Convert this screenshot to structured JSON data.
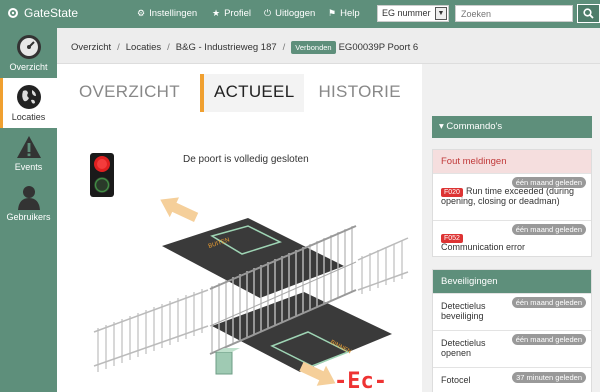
{
  "app": {
    "title": "GateState"
  },
  "topnav": {
    "instellingen": "Instellingen",
    "profiel": "Profiel",
    "uitloggen": "Uitloggen",
    "help": "Help"
  },
  "search": {
    "select_value": "EG nummer",
    "placeholder": "Zoeken"
  },
  "sidebar": {
    "items": [
      {
        "label": "Overzicht",
        "icon": "gauge-icon"
      },
      {
        "label": "Locaties",
        "icon": "globe-icon"
      },
      {
        "label": "Events",
        "icon": "warning-icon"
      },
      {
        "label": "Gebruikers",
        "icon": "user-icon"
      }
    ]
  },
  "breadcrumb": {
    "items": [
      "Overzicht",
      "Locaties",
      "B&G - Industrieweg 187"
    ],
    "badge": "Verbonden",
    "current": "EG00039P Poort 6"
  },
  "tabs": [
    "OVERZICHT",
    "ACTUEEL",
    "HISTORIE"
  ],
  "status": {
    "text": "De poort is volledig gesloten"
  },
  "gate": {
    "label_outside": "BUITEN",
    "label_inside": "BINNEN",
    "display": "-Ec-"
  },
  "commands": {
    "label": "Commando's"
  },
  "faults": {
    "title": "Fout meldingen",
    "items": [
      {
        "code": "F020",
        "text": "Run time exceeded (during opening, closing or deadman)",
        "ago": "één maand geleden"
      },
      {
        "code": "F052",
        "text": "Communication error",
        "ago": "één maand geleden"
      }
    ]
  },
  "security": {
    "title": "Beveiligingen",
    "items": [
      {
        "text": "Detectielus beveiliging",
        "ago": "één maand geleden"
      },
      {
        "text": "Detectielus openen",
        "ago": "één maand geleden"
      },
      {
        "text": "Fotocel",
        "ago": "37 minuten geleden"
      }
    ]
  },
  "colors": {
    "primary": "#5e8f7b",
    "accent": "#f0a030",
    "error": "#d33333"
  }
}
